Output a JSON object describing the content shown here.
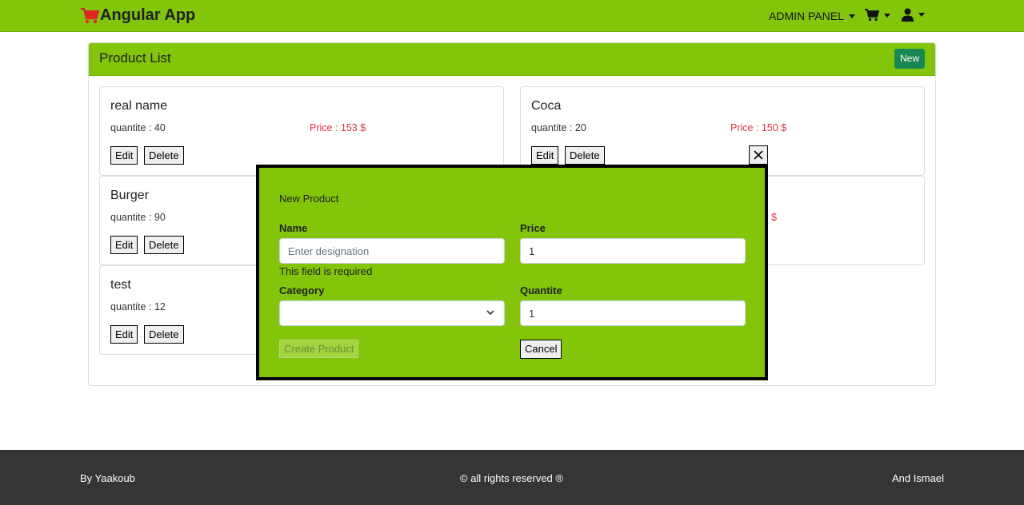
{
  "app": {
    "brand": "Angular App",
    "brand_icon": "shopping-cart-icon",
    "accent_color": "#82c50a"
  },
  "nav": {
    "admin_panel": "ADMIN PANEL"
  },
  "product_list": {
    "title": "Product List",
    "new_label": "New",
    "edit_label": "Edit",
    "delete_label": "Delete",
    "products": [
      {
        "name": "real name",
        "quantity": "quantite : 40",
        "price": "Price : 153 $"
      },
      {
        "name": "Coca",
        "quantity": "quantite : 20",
        "price": "Price : 150 $"
      },
      {
        "name": "Burger",
        "quantity": "quantite : 90",
        "price": "$"
      },
      {
        "name": "test",
        "quantity": "quantite : 12",
        "price": ""
      }
    ]
  },
  "modal": {
    "title": "New Product",
    "name_label": "Name",
    "name_placeholder": "Enter designation",
    "name_error": "This field is required",
    "price_label": "Price",
    "price_value": "1",
    "category_label": "Category",
    "category_value": "",
    "quantite_label": "Quantite",
    "quantite_value": "1",
    "create_label": "Create Product",
    "cancel_label": "Cancel"
  },
  "footer": {
    "left": "By Yaakoub",
    "center": "© all rights reserved ®",
    "right": "And Ismael"
  }
}
